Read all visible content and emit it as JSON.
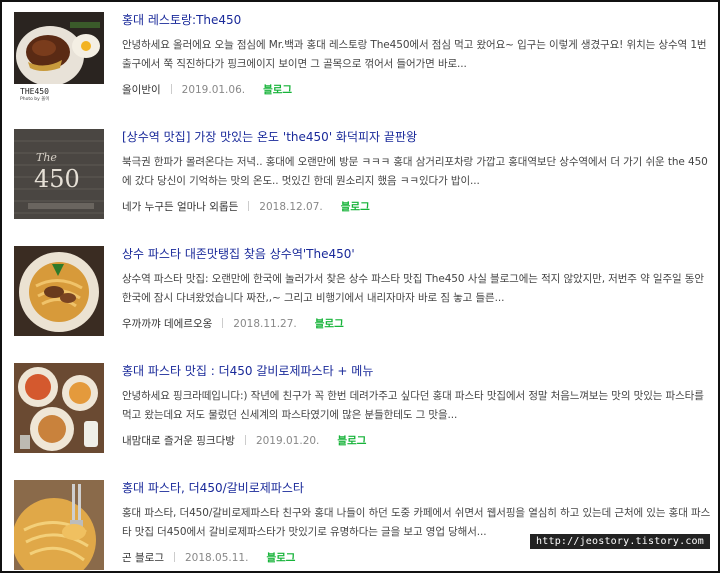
{
  "results": [
    {
      "title": "홍대 레스토랑:The450",
      "snippet": "안녕하세요 올러에요 오늘 점심에 Mr.백과 홍대 레스토랑 The450에서 점심 먹고 왔어요~ 입구는 이렇게 생겼구요! 위치는 상수역 1번출구에서 쭉 직진하다가 핑크에이지 보이면 그 골목으로 꺾어서 들어가면 바로...",
      "author": "올이반이",
      "date": "2019.01.06.",
      "source": "블로그",
      "thumb_caption": "THE450",
      "thumb_subcaption": "Photo by 올이"
    },
    {
      "title": "[상수역 맛집] 가장 맛있는 온도 'the450' 화덕피자 끝판왕",
      "snippet": "북극권 한파가 몰려온다는 저녁.. 홍대에 오랜만에 방문 ㅋㅋㅋ 홍대 삼거리포차랑 가깝고 홍대역보단 상수역에서 더 가기 쉬운 the 450에 갔다 당신이 기억하는 맛의 온도.. 멋있긴 한데 뭔소리지 했음 ㅋㅋ있다가 밥이...",
      "author": "네가 누구든 얼마나 외롭든",
      "date": "2018.12.07.",
      "source": "블로그",
      "thumb_caption": "The 450"
    },
    {
      "title": "상수 파스타 대존맛탱집 찾음 상수역'The450'",
      "snippet": "상수역 파스타 맛집: 오랜만에 한국에 놀러가서 찾은 상수 파스타 맛집 The450 사실 블로그에는 적지 않았지만, 저번주 약 일주일 동안 한국에 잠시 다녀왔었습니다 짜잔,,~ 그리고 비행기에서 내리자마자 바로 짐 놓고 들른...",
      "author": "우까까꺄 데에르오옹",
      "date": "2018.11.27.",
      "source": "블로그"
    },
    {
      "title": "홍대 파스타 맛집 : 더450 갈비로제파스타 + 메뉴",
      "snippet": "안녕하세요 핑크라떼입니다:) 작년에 친구가 꼭 한번 데려가주고 싶다던 홍대 파스타 맛집에서 정말 처음느껴보는 맛의 맛있는 파스타를 먹고 왔는데요 저도 물렀던 신세계의 파스타였기에 많은 분들한테도 그 맛을...",
      "author": "내맘대로 즐거운 핑크다방",
      "date": "2019.01.20.",
      "source": "블로그"
    },
    {
      "title": "홍대 파스타, 더450/갈비로제파스타",
      "snippet": "홍대 파스타, 더450/갈비로제파스타 친구와 홍대 나들이 하던 도중 카페에서 쉬면서 웹서핑을 열심히 하고 있는데 근처에 있는 홍대 파스타 맛집 더450에서 갈비로제파스타가 맛있기로 유명하다는 글을 보고 영업 당해서...",
      "author": "곤 블로그",
      "date": "2018.05.11.",
      "source": "블로그"
    }
  ],
  "watermark": "http://jeostory.tistory.com",
  "colors": {
    "title": "#1a2a9a",
    "source": "#17b33a",
    "frame": "#111111"
  },
  "icons": [
    "food-photo",
    "restaurant-sign-photo",
    "pasta-photo",
    "table-spread-photo",
    "fork-pasta-photo"
  ]
}
